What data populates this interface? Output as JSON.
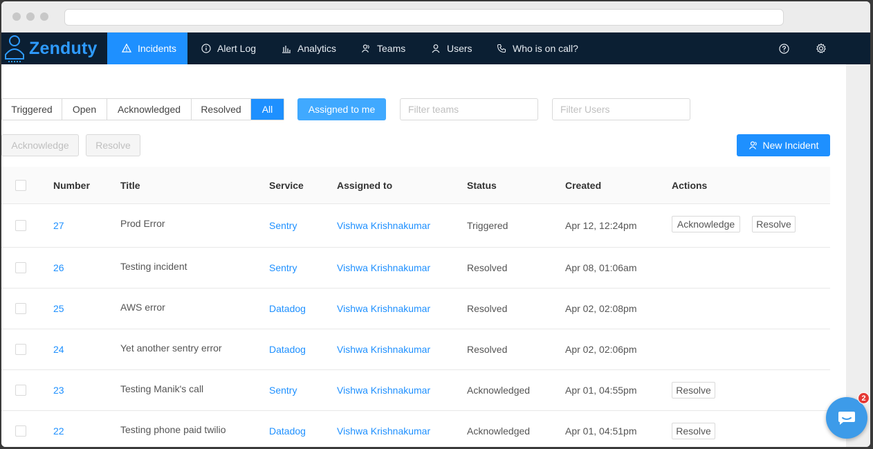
{
  "nav": {
    "logo_text": "Zenduty",
    "items": [
      {
        "label": "Incidents",
        "icon": "warning-icon"
      },
      {
        "label": "Alert Log",
        "icon": "info-icon"
      },
      {
        "label": "Analytics",
        "icon": "bar-chart-icon"
      },
      {
        "label": "Teams",
        "icon": "team-icon"
      },
      {
        "label": "Users",
        "icon": "user-icon"
      },
      {
        "label": "Who is on call?",
        "icon": "phone-icon"
      }
    ],
    "active": "Incidents"
  },
  "filters": {
    "segments": [
      "Triggered",
      "Open",
      "Acknowledged",
      "Resolved",
      "All"
    ],
    "active_segment": "All",
    "assigned_label": "Assigned to me",
    "teams_placeholder": "Filter teams",
    "users_placeholder": "Filter Users"
  },
  "bulk": {
    "acknowledge_label": "Acknowledge",
    "resolve_label": "Resolve",
    "new_incident_label": "New Incident"
  },
  "table": {
    "headers": [
      "Number",
      "Title",
      "Service",
      "Assigned to",
      "Status",
      "Created",
      "Actions"
    ],
    "rows": [
      {
        "number": "27",
        "title": "Prod Error",
        "service": "Sentry",
        "assigned": "Vishwa Krishnakumar",
        "status": "Triggered",
        "created": "Apr 12, 12:24pm",
        "actions": [
          "Acknowledge",
          "Resolve"
        ]
      },
      {
        "number": "26",
        "title": "Testing incident",
        "service": "Sentry",
        "assigned": "Vishwa Krishnakumar",
        "status": "Resolved",
        "created": "Apr 08, 01:06am",
        "actions": []
      },
      {
        "number": "25",
        "title": "AWS error",
        "service": "Datadog",
        "assigned": "Vishwa Krishnakumar",
        "status": "Resolved",
        "created": "Apr 02, 02:08pm",
        "actions": []
      },
      {
        "number": "24",
        "title": "Yet another sentry error",
        "service": "Datadog",
        "assigned": "Vishwa Krishnakumar",
        "status": "Resolved",
        "created": "Apr 02, 02:06pm",
        "actions": []
      },
      {
        "number": "23",
        "title": "Testing Manik's call",
        "service": "Sentry",
        "assigned": "Vishwa Krishnakumar",
        "status": "Acknowledged",
        "created": "Apr 01, 04:55pm",
        "actions": [
          "Resolve"
        ]
      },
      {
        "number": "22",
        "title": "Testing phone paid twilio",
        "service": "Datadog",
        "assigned": "Vishwa Krishnakumar",
        "status": "Acknowledged",
        "created": "Apr 01, 04:51pm",
        "actions": [
          "Resolve"
        ]
      }
    ]
  },
  "chat": {
    "badge_count": "2"
  },
  "colors": {
    "nav_bg": "#0b1f33",
    "accent": "#1e90ff",
    "link": "#1e90ff",
    "badge": "#e53935"
  }
}
